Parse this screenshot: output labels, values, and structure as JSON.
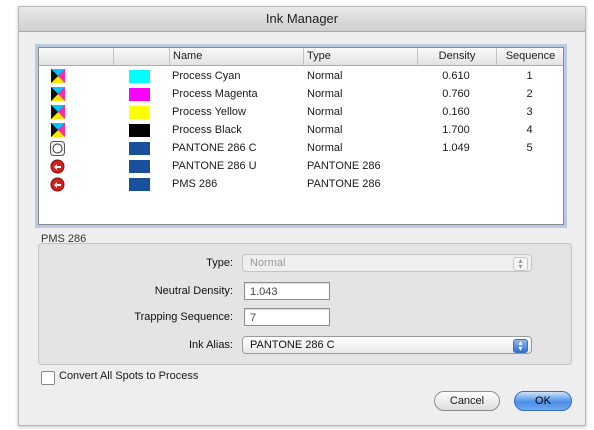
{
  "window": {
    "title": "Ink Manager"
  },
  "table": {
    "columns": {
      "name": "Name",
      "type": "Type",
      "density": "Density",
      "sequence": "Sequence"
    },
    "rows": [
      {
        "kind": "process",
        "swatch": "#00ffff",
        "name": "Process Cyan",
        "type": "Normal",
        "density": "0.610",
        "sequence": "1"
      },
      {
        "kind": "process",
        "swatch": "#ff00ff",
        "name": "Process Magenta",
        "type": "Normal",
        "density": "0.760",
        "sequence": "2"
      },
      {
        "kind": "process",
        "swatch": "#ffff00",
        "name": "Process Yellow",
        "type": "Normal",
        "density": "0.160",
        "sequence": "3"
      },
      {
        "kind": "process",
        "swatch": "#000000",
        "name": "Process Black",
        "type": "Normal",
        "density": "1.700",
        "sequence": "4"
      },
      {
        "kind": "spot",
        "swatch": "#1a4f9c",
        "name": "PANTONE 286 C",
        "type": "Normal",
        "density": "1.049",
        "sequence": "5"
      },
      {
        "kind": "alias",
        "swatch": "#1a4f9c",
        "name": "PANTONE 286 U",
        "type": "PANTONE 286",
        "density": "",
        "sequence": ""
      },
      {
        "kind": "alias",
        "swatch": "#1a4f9c",
        "name": "PMS 286",
        "type": "PANTONE 286",
        "density": "",
        "sequence": ""
      }
    ]
  },
  "details": {
    "selected_ink": "PMS 286",
    "type_label": "Type:",
    "type_value": "Normal",
    "neutral_density_label": "Neutral Density:",
    "neutral_density_value": "1.043",
    "trapping_sequence_label": "Trapping Sequence:",
    "trapping_sequence_value": "7",
    "ink_alias_label": "Ink Alias:",
    "ink_alias_value": "PANTONE 286 C"
  },
  "options": {
    "convert_spots_label": "Convert All Spots to Process",
    "convert_spots_checked": false
  },
  "buttons": {
    "cancel": "Cancel",
    "ok": "OK"
  },
  "colors": {
    "selection_border": "#b9cbe3",
    "ok_button": "#4b8fe8",
    "alias_icon": "#d62020"
  }
}
